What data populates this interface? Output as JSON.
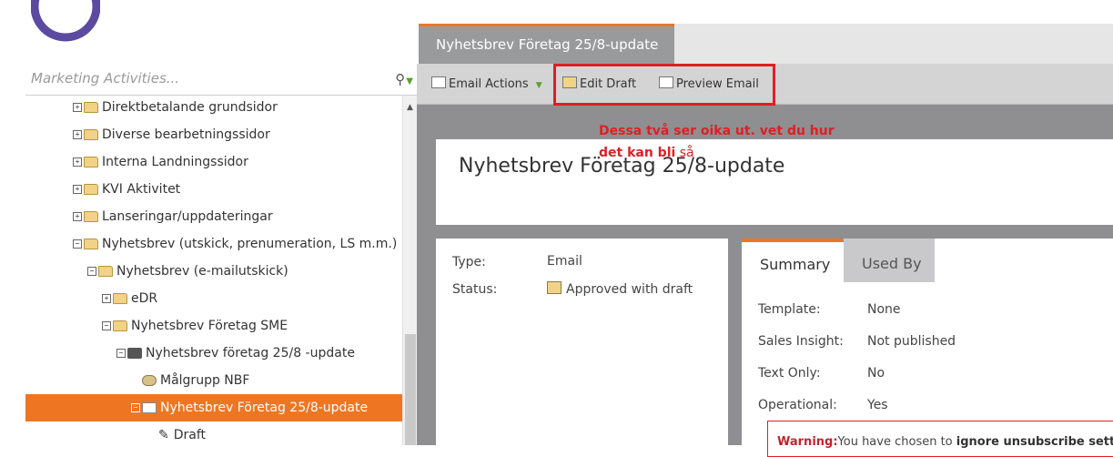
{
  "sidebar": {
    "search_placeholder": "Marketing Activities...",
    "tree": [
      {
        "label": "Direktbetalande grundsidor",
        "exp": "+",
        "icon": "folder-icon"
      },
      {
        "label": "Diverse bearbetningssidor",
        "exp": "+",
        "icon": "folder-icon"
      },
      {
        "label": "Interna Landningssidor",
        "exp": "+",
        "icon": "folder-icon"
      },
      {
        "label": "KVI Aktivitet",
        "exp": "+",
        "icon": "folder-icon"
      },
      {
        "label": "Lanseringar/uppdateringar",
        "exp": "+",
        "icon": "folder-icon"
      },
      {
        "label": "Nyhetsbrev (utskick, prenumeration, LS m.m.)",
        "exp": "−",
        "icon": "folder-open-icon"
      },
      {
        "label": "Nyhetsbrev (e-mailutskick)",
        "exp": "−",
        "icon": "folder-open-icon"
      },
      {
        "label": "eDR",
        "exp": "+",
        "icon": "folder-icon"
      },
      {
        "label": "Nyhetsbrev Företag SME",
        "exp": "−",
        "icon": "folder-open-icon"
      },
      {
        "label": "Nyhetsbrev företag 25/8 -update",
        "exp": "−",
        "icon": "program-icon"
      },
      {
        "label": "Målgrupp NBF",
        "exp": "",
        "icon": "list-icon"
      },
      {
        "label": "Nyhetsbrev Företag 25/8-update",
        "exp": "−",
        "icon": "email-icon"
      },
      {
        "label": "Draft",
        "exp": "",
        "icon": "pencil-icon"
      }
    ]
  },
  "tab": {
    "title": "Nyhetsbrev Företag 25/8-update"
  },
  "toolbar": {
    "email_actions": "Email Actions",
    "edit_draft": "Edit Draft",
    "preview_email": "Preview Email"
  },
  "annotation": {
    "line1": "Dessa två ser oika ut. vet du hur",
    "line2_bold": "det kan bli",
    "line2_normal": " så"
  },
  "header": {
    "title": "Nyhetsbrev Företag 25/8-update"
  },
  "info": {
    "type_label": "Type:",
    "type_value": "Email",
    "status_label": "Status:",
    "status_value": "Approved with draft"
  },
  "summary": {
    "tab_summary": "Summary",
    "tab_used_by": "Used By",
    "rows": [
      {
        "label": "Template:",
        "value": "None"
      },
      {
        "label": "Sales Insight:",
        "value": "Not published"
      },
      {
        "label": "Text Only:",
        "value": "No"
      },
      {
        "label": "Operational:",
        "value": "Yes"
      }
    ],
    "warning_prefix": "Warning:",
    "warning_text": "You have chosen to ",
    "warning_bold": "ignore unsubscribe settin"
  },
  "colors": {
    "accent": "#ee7623",
    "annotation_red": "#e01e24",
    "logo_purple": "#5b4aa0"
  }
}
